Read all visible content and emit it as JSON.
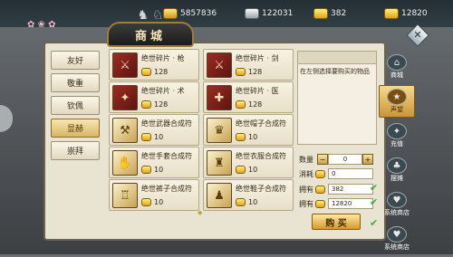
{
  "topbar": {
    "currencies": [
      {
        "icon": "copper-coin-icon",
        "value": "5857836"
      },
      {
        "icon": "silver-ingot-icon",
        "value": "122031"
      },
      {
        "icon": "gold-ingot-icon",
        "value": "382"
      },
      {
        "icon": "gold-ingot-bound-icon",
        "value": "12820"
      }
    ]
  },
  "header": {
    "title": "商城"
  },
  "categories": [
    {
      "label": "友好",
      "active": false
    },
    {
      "label": "敬重",
      "active": false
    },
    {
      "label": "钦佩",
      "active": false
    },
    {
      "label": "显赫",
      "active": true
    },
    {
      "label": "崇拜",
      "active": false
    }
  ],
  "items": [
    {
      "name": "绝世碎片 · 枪",
      "price": "128",
      "icon": "spear-icon",
      "style": "red"
    },
    {
      "name": "绝世碎片 · 剑",
      "price": "128",
      "icon": "sword-icon",
      "style": "red"
    },
    {
      "name": "绝世碎片 · 术",
      "price": "128",
      "icon": "spell-icon",
      "style": "red"
    },
    {
      "name": "绝世碎片 · 医",
      "price": "128",
      "icon": "heal-icon",
      "style": "red"
    },
    {
      "name": "绝世武器合成符",
      "price": "10",
      "icon": "weapon-talisman-icon",
      "style": "gold"
    },
    {
      "name": "绝世帽子合成符",
      "price": "10",
      "icon": "hat-talisman-icon",
      "style": "gold"
    },
    {
      "name": "绝世手套合成符",
      "price": "10",
      "icon": "glove-talisman-icon",
      "style": "gold"
    },
    {
      "name": "绝世衣服合成符",
      "price": "10",
      "icon": "clothes-talisman-icon",
      "style": "gold"
    },
    {
      "name": "绝世裤子合成符",
      "price": "10",
      "icon": "pants-talisman-icon",
      "style": "gold"
    },
    {
      "name": "绝世鞋子合成符",
      "price": "10",
      "icon": "shoes-talisman-icon",
      "style": "gold"
    }
  ],
  "detail": {
    "hint": "在左侧选择要购买的物品"
  },
  "purchase": {
    "qty_label": "数量",
    "qty_value": "0",
    "cost_label": "消耗",
    "cost_value": "0",
    "owned_label": "拥有",
    "owned_gold": "382",
    "owned_bound": "12820",
    "buy_label": "购 买"
  },
  "sidetabs": [
    {
      "label": "商城",
      "icon": "shop-icon",
      "active": false
    },
    {
      "label": "声望",
      "icon": "reputation-icon",
      "active": true
    },
    {
      "label": "充值",
      "icon": "recharge-icon",
      "active": false
    },
    {
      "label": "摆摊",
      "icon": "stall-icon",
      "active": false
    },
    {
      "label": "系统商店",
      "icon": "system-store-icon",
      "active": false
    },
    {
      "label": "系统商店",
      "icon": "system-store-2-icon",
      "active": false
    }
  ],
  "colors": {
    "accent": "#d59a2e",
    "panel": "#e9e3d2",
    "active_tab": "#f7d98c"
  }
}
